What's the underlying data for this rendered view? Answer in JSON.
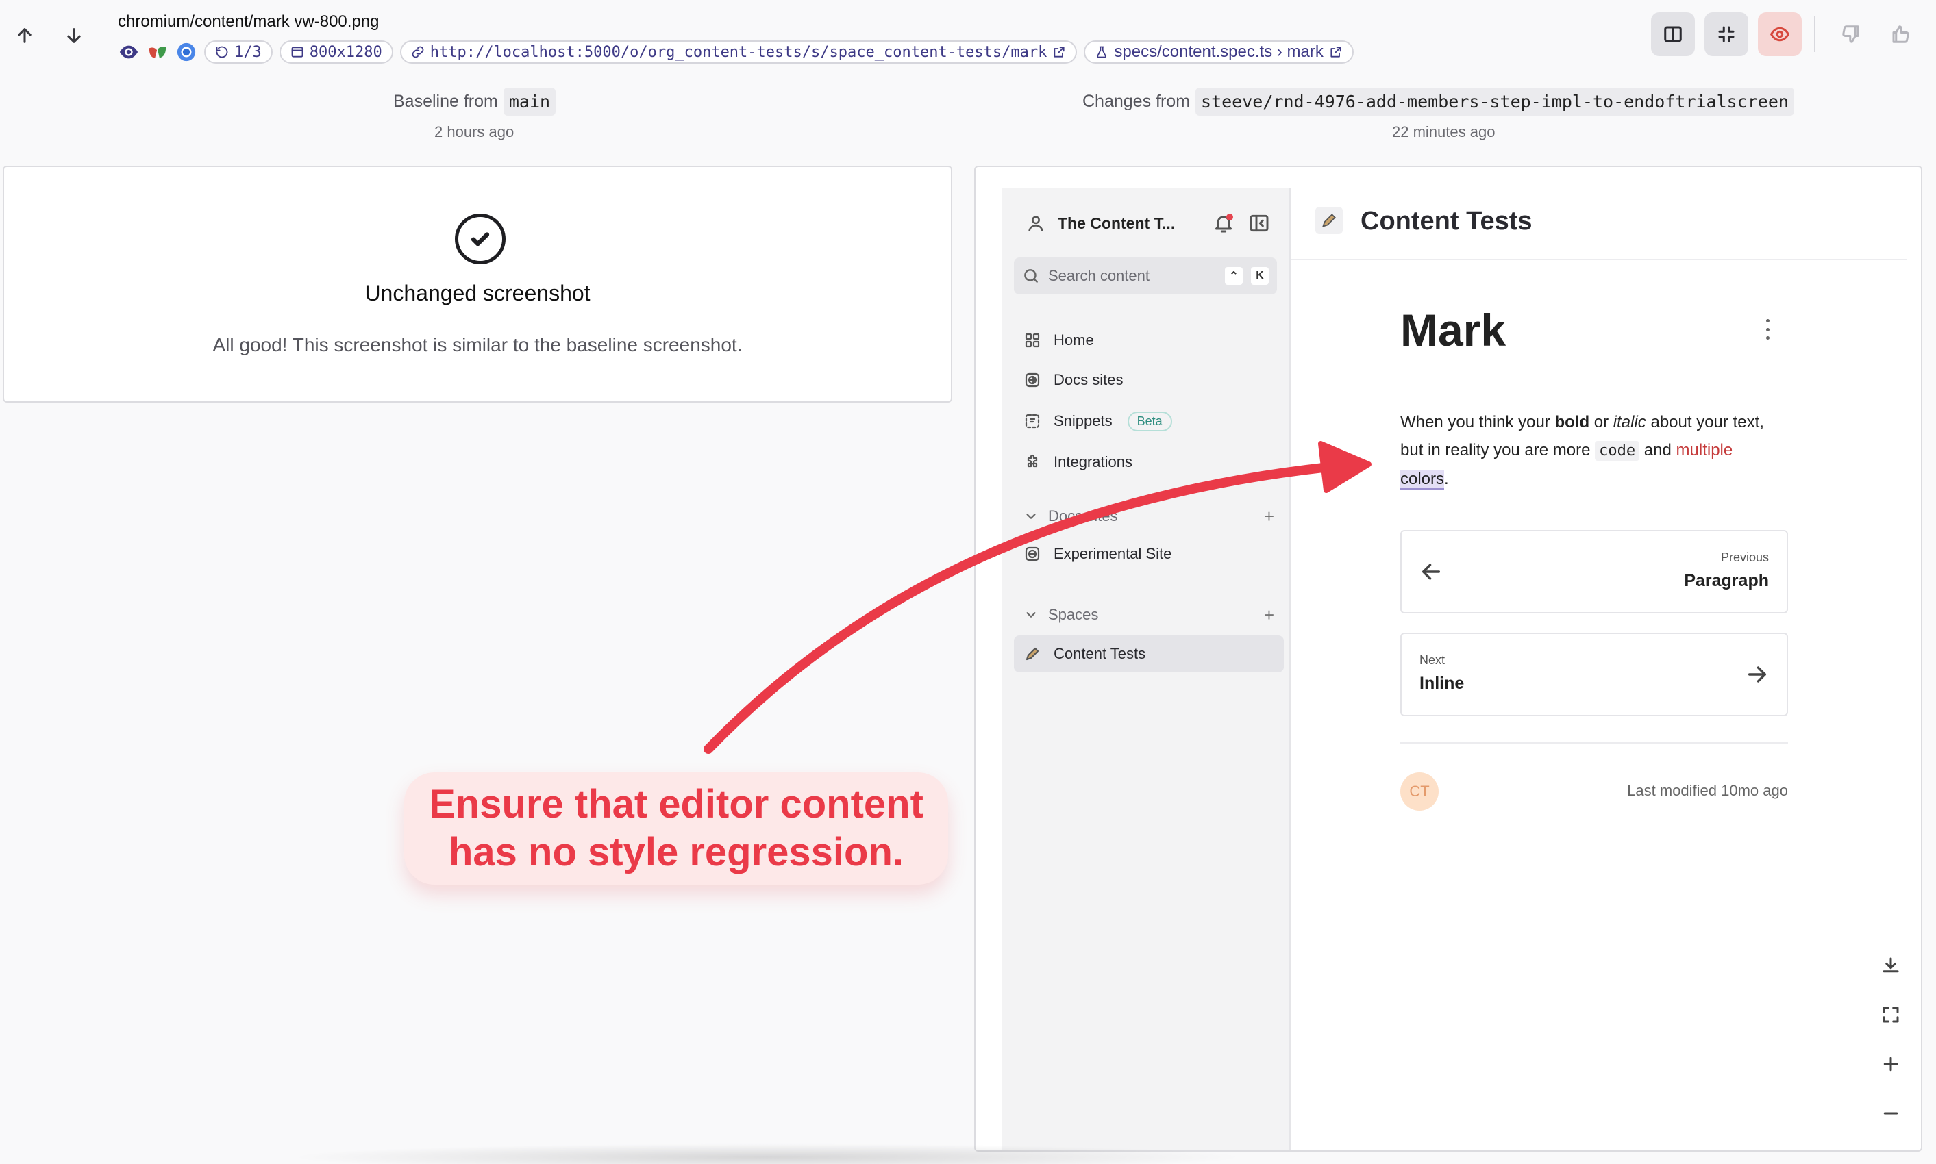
{
  "header": {
    "file_name": "chromium/content/mark vw-800.png",
    "browser_icons": [
      "eye-icon",
      "playwright-icon",
      "chromium-icon"
    ],
    "retry": "1/3",
    "viewport": "800x1280",
    "url": "http://localhost:5000/o/org_content-tests/s/space_content-tests/mark",
    "spec": "specs/content.spec.ts › mark"
  },
  "toolbar": {
    "buttons": [
      "split-view-icon",
      "collapse-icon",
      "visibility-icon",
      "thumbs-down-icon",
      "thumbs-up-icon"
    ],
    "accent_color": "#f3d9d9"
  },
  "baseline": {
    "label": "Baseline from",
    "branch": "main",
    "time": "2 hours ago"
  },
  "changes": {
    "label": "Changes from",
    "branch": "steeve/rnd-4976-add-members-step-impl-to-endoftrialscreen",
    "time": "22 minutes ago"
  },
  "left_panel": {
    "title": "Unchanged screenshot",
    "message": "All good! This screenshot is similar to the baseline screenshot."
  },
  "app": {
    "org_name": "The Content T...",
    "search_placeholder": "Search content",
    "search_kbd": [
      "⌃",
      "K"
    ],
    "nav": [
      {
        "label": "Home",
        "icon": "grid-icon"
      },
      {
        "label": "Docs sites",
        "icon": "globe-icon"
      },
      {
        "label": "Snippets",
        "icon": "snippet-icon",
        "badge": "Beta"
      },
      {
        "label": "Integrations",
        "icon": "puzzle-icon"
      }
    ],
    "docs_section": "Docs sites",
    "docs_item": "Experimental Site",
    "spaces_section": "Spaces",
    "space_item": "Content Tests",
    "page_header": "Content Tests",
    "doc_title": "Mark",
    "para": {
      "p1": "When you think your ",
      "bold": "bold",
      "p2": " or ",
      "italic": "italic",
      "p3": " about your text, but in reality you are more ",
      "code": "code",
      "p4": " and ",
      "red": "multiple",
      "p5": " ",
      "highlight": "colors",
      "p6": "."
    },
    "prev": {
      "small": "Previous",
      "big": "Paragraph"
    },
    "next": {
      "small": "Next",
      "big": "Inline"
    },
    "avatar": "CT",
    "last_modified": "Last modified 10mo ago"
  },
  "annotation": {
    "line1": "Ensure that editor content",
    "line2": "has no style regression.",
    "color": "#ea3a48"
  },
  "controls": [
    "download-icon",
    "fullscreen-icon",
    "zoom-in-icon",
    "zoom-out-icon"
  ]
}
